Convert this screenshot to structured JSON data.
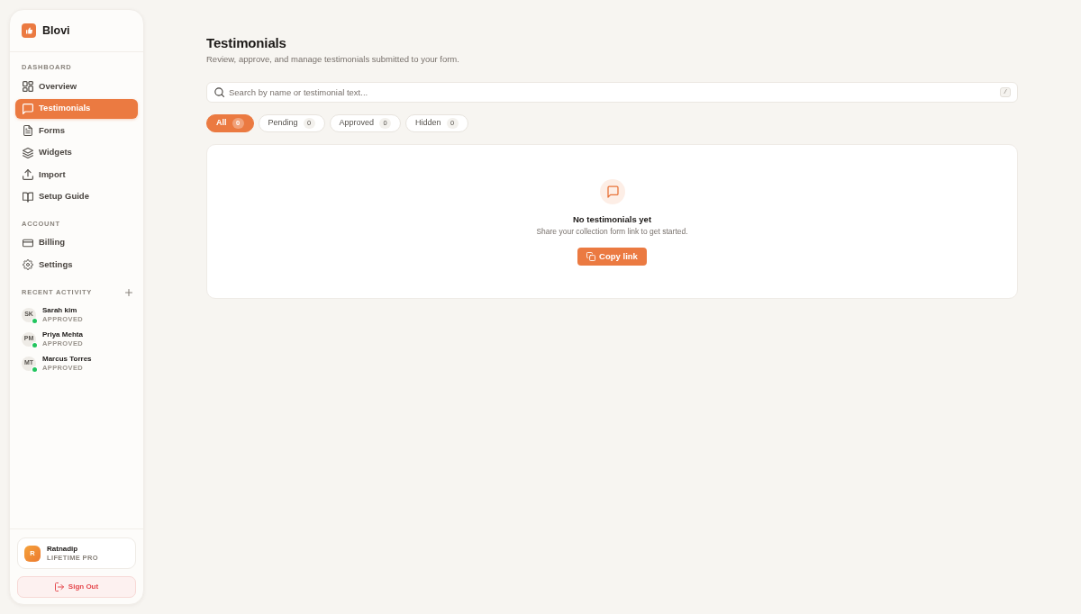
{
  "sidebar": {
    "brand": "Blovi",
    "sections": [
      {
        "heading": "DASHBOARD",
        "items": [
          {
            "label": "Overview",
            "selected": false
          },
          {
            "label": "Testimonials",
            "selected": true
          },
          {
            "label": "Forms",
            "selected": false
          },
          {
            "label": "Widgets",
            "selected": false
          },
          {
            "label": "Import",
            "selected": false
          },
          {
            "label": "Setup Guide",
            "selected": false
          }
        ]
      },
      {
        "heading": "ACCOUNT",
        "items": [
          {
            "label": "Billing",
            "selected": false
          },
          {
            "label": "Settings",
            "selected": false
          }
        ]
      }
    ],
    "recent_activity": {
      "heading": "RECENT ACTIVITY",
      "items": [
        {
          "initials": "SK",
          "name": "Sarah kim",
          "status": "APPROVED",
          "color": "#22c55e"
        },
        {
          "initials": "PM",
          "name": "Priya Mehta",
          "status": "APPROVED",
          "color": "#22c55e"
        },
        {
          "initials": "MT",
          "name": "Marcus Torres",
          "status": "APPROVED",
          "color": "#22c55e"
        }
      ]
    },
    "user": {
      "initial": "R",
      "name": "Ratnadip",
      "plan": "LIFETIME PRO"
    },
    "sign_out": "Sign Out"
  },
  "main": {
    "title": "Testimonials",
    "subtitle": "Review, approve, and manage testimonials submitted to your form.",
    "search": {
      "placeholder": "Search by name or testimonial text...",
      "shortcut": "/"
    },
    "filters": [
      {
        "label": "All",
        "count": "0",
        "selected": true
      },
      {
        "label": "Pending",
        "count": "0",
        "selected": false
      },
      {
        "label": "Approved",
        "count": "0",
        "selected": false
      },
      {
        "label": "Hidden",
        "count": "0",
        "selected": false
      }
    ],
    "empty_state": {
      "title": "No testimonials yet",
      "text": "Share your collection form link to get started.",
      "button": "Copy link"
    }
  }
}
